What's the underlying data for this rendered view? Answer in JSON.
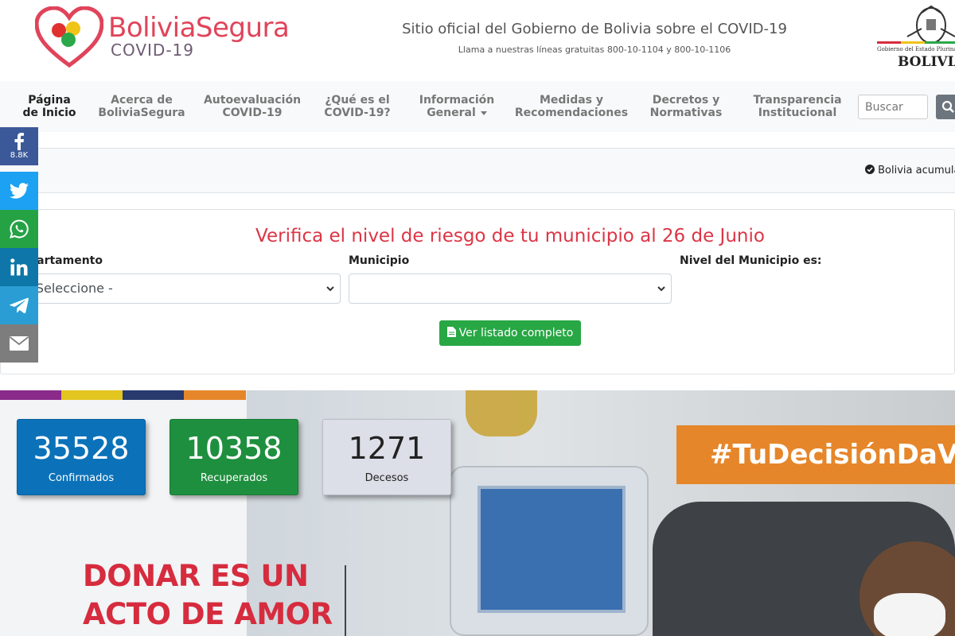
{
  "header": {
    "logo_title": "BoliviaSegura",
    "logo_subtitle": "COVID-19",
    "site_title": "Sitio oficial del Gobierno de Bolivia sobre el COVID-19",
    "site_subtitle": "Llama a nuestras líneas gratuitas 800-10-1104 y 800-10-1106",
    "gov_small": "Gobierno del Estado Plurinacional de",
    "gov_big": "BOLIVIA"
  },
  "nav": {
    "items": [
      {
        "line1": "Página",
        "line2": "de Inicio"
      },
      {
        "line1": "Acerca de",
        "line2": "BoliviaSegura"
      },
      {
        "line1": "Autoevaluación",
        "line2": "COVID-19"
      },
      {
        "line1": "¿Qué es el",
        "line2": "COVID-19?"
      },
      {
        "line1": "Información",
        "line2": "General"
      },
      {
        "line1": "Medidas y",
        "line2": "Recomendaciones"
      },
      {
        "line1": "Decretos y",
        "line2": "Normativas"
      },
      {
        "line1": "Transparencia",
        "line2": "Institucional"
      }
    ],
    "search_placeholder": "Buscar"
  },
  "ticker": {
    "text": "Bolivia acumula"
  },
  "risk": {
    "title": "Verifica el nivel de riesgo de tu municipio al 26 de Junio",
    "label_departamento": "Departamento",
    "label_municipio": "Municipio",
    "label_nivel": "Nivel del Municipio es:",
    "departamento_value": "- Seleccione -",
    "municipio_value": "",
    "button_label": "Ver listado completo"
  },
  "share": {
    "facebook_count": "8.8K"
  },
  "hero": {
    "stats": [
      {
        "value": "35528",
        "label": "Confirmados"
      },
      {
        "value": "10358",
        "label": "Recuperados"
      },
      {
        "value": "1271",
        "label": "Decesos"
      }
    ],
    "hashtag": "#TuDecisiónDaVida",
    "slogan_line1": "DONAR ES UN",
    "slogan_line2": "ACTO DE AMOR"
  },
  "colors": {
    "brand_red": "#e0445a",
    "confirmados": "#0b72b9",
    "recuperados": "#1e8f3e",
    "decesos": "#dcdfe8",
    "button_green": "#28a745",
    "title_red": "#dc3545",
    "hashtag_orange": "#e6862a"
  }
}
